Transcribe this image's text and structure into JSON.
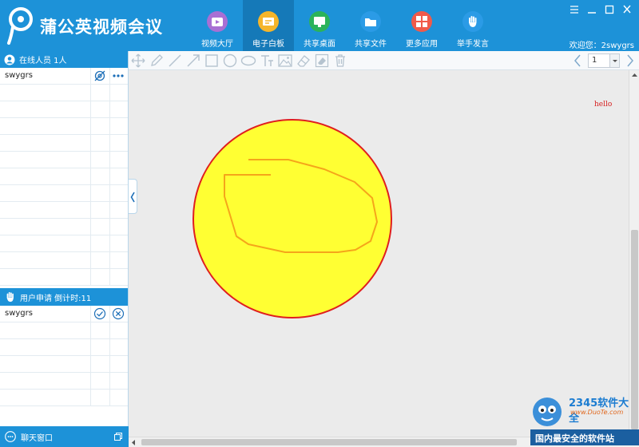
{
  "app": {
    "title": "蒲公英视频会议",
    "welcome": "欢迎您：2swygrs"
  },
  "nav": [
    {
      "label": "视频大厅",
      "icon": "video-hall-icon",
      "color": "#a86fd4"
    },
    {
      "label": "电子白板",
      "icon": "whiteboard-icon",
      "color": "#f5b52a",
      "active": true
    },
    {
      "label": "共享桌面",
      "icon": "share-desktop-icon",
      "color": "#2bb35a"
    },
    {
      "label": "共享文件",
      "icon": "share-file-icon",
      "color": "#2b9be6"
    },
    {
      "label": "更多应用",
      "icon": "more-apps-icon",
      "color": "#f05a4a"
    },
    {
      "label": "举手发言",
      "icon": "raise-hand-icon",
      "color": "#2b9be6"
    }
  ],
  "sidebar": {
    "online_header": "在线人员 1人",
    "online_users": [
      "swygrs"
    ],
    "request_header": "用户申请 倒计时:11",
    "requests": [
      "swygrs"
    ],
    "chat_label": "聊天窗口"
  },
  "toolbar": {
    "tools": [
      "move-icon",
      "pencil-icon",
      "line-icon",
      "arrow-icon",
      "rectangle-icon",
      "circle-icon",
      "ellipse-icon",
      "text-icon",
      "image-icon",
      "eraser-icon",
      "clear-icon",
      "delete-icon"
    ],
    "page": "1"
  },
  "canvas": {
    "annotation": "hello",
    "fill_color": "#ffff33",
    "stroke_color": "#e01e1e",
    "scribble_color": "#f5a51a"
  },
  "watermark": {
    "logo": "2345软件大全",
    "url": "www.DuoTe.com",
    "tag": "国内最安全的软件站"
  }
}
